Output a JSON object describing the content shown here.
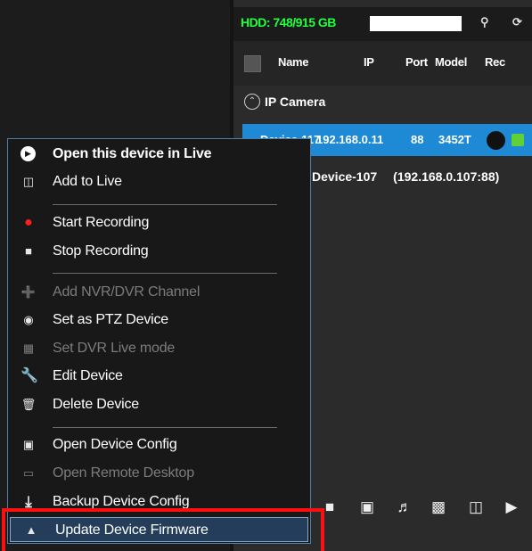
{
  "topbar": {
    "hdd_text": "HDD: 748/915 GB",
    "icons": [
      "search-icon",
      "refresh-icon"
    ]
  },
  "table": {
    "columns": [
      "Name",
      "IP",
      "Port",
      "Model",
      "Rec"
    ],
    "group_label": "IP Camera",
    "selected_row": {
      "name": "Device-117",
      "ip": "192.168.0.11",
      "port": "88",
      "model": "3452T"
    },
    "device_row": {
      "name": "Device-107",
      "address": "(192.168.0.107:88)"
    }
  },
  "context_menu": {
    "items": [
      {
        "label": "Open this device in Live",
        "icon": "play-circle-icon"
      },
      {
        "label": "Add to Live",
        "icon": "add-to-live-icon"
      },
      {
        "label": "Start Recording",
        "icon": "record-dot-icon"
      },
      {
        "label": "Stop Recording",
        "icon": "stop-square-icon"
      },
      {
        "label": "Add NVR/DVR Channel",
        "icon": "add-channel-icon"
      },
      {
        "label": "Set as PTZ Device",
        "icon": "ptz-eye-icon"
      },
      {
        "label": "Set DVR Live mode",
        "icon": "grid-icon"
      },
      {
        "label": "Edit Device",
        "icon": "wrench-icon"
      },
      {
        "label": "Delete Device",
        "icon": "trash-icon"
      },
      {
        "label": "Open Device Config",
        "icon": "camera-config-icon"
      },
      {
        "label": "Open Remote Desktop",
        "icon": "remote-desktop-icon"
      },
      {
        "label": "Backup Device Config",
        "icon": "download-icon"
      },
      {
        "label": "Update Device Firmware",
        "icon": "firmware-upload-icon"
      }
    ]
  },
  "bottom_toolbar": {
    "icons": [
      "stop-icon",
      "snapshot-icon",
      "audio-icon",
      "playback-icon",
      "add-live-icon",
      "play-icon"
    ]
  },
  "colors": {
    "hdd_text": "#21ff3f",
    "selected_row": "#1e8ad6",
    "rec_green": "#5fd135",
    "record_red": "#ff1f1f",
    "highlight_box": "#ff1010"
  }
}
